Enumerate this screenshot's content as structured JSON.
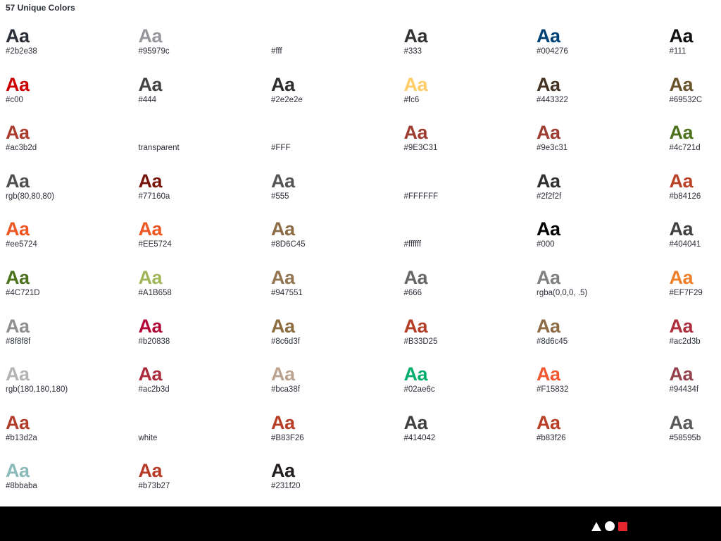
{
  "heading": "57 Unique Colors",
  "sample_text": "Aa",
  "colors": [
    {
      "label": "#2b2e38",
      "color": "#2b2e38"
    },
    {
      "label": "#95979c",
      "color": "#95979c"
    },
    {
      "label": "#fff",
      "color": "#ffffff"
    },
    {
      "label": "#333",
      "color": "#333333"
    },
    {
      "label": "#004276",
      "color": "#004276"
    },
    {
      "label": "#111",
      "color": "#111111"
    },
    {
      "label": "#c00",
      "color": "#cc0000"
    },
    {
      "label": "#444",
      "color": "#444444"
    },
    {
      "label": "#2e2e2e",
      "color": "#2e2e2e"
    },
    {
      "label": "#fc6",
      "color": "#ffcc66"
    },
    {
      "label": "#443322",
      "color": "#443322"
    },
    {
      "label": "#69532C",
      "color": "#69532c"
    },
    {
      "label": "#ac3b2d",
      "color": "#ac3b2d"
    },
    {
      "label": "transparent",
      "color": "transparent"
    },
    {
      "label": "#FFF",
      "color": "#ffffff"
    },
    {
      "label": "#9E3C31",
      "color": "#9e3c31"
    },
    {
      "label": "#9e3c31",
      "color": "#9e3c31"
    },
    {
      "label": "#4c721d",
      "color": "#4c721d"
    },
    {
      "label": "rgb(80,80,80)",
      "color": "#505050"
    },
    {
      "label": "#77160a",
      "color": "#77160a"
    },
    {
      "label": "#555",
      "color": "#555555"
    },
    {
      "label": "#FFFFFF",
      "color": "#ffffff"
    },
    {
      "label": "#2f2f2f",
      "color": "#2f2f2f"
    },
    {
      "label": "#b84126",
      "color": "#b84126"
    },
    {
      "label": "#ee5724",
      "color": "#ee5724"
    },
    {
      "label": "#EE5724",
      "color": "#ee5724"
    },
    {
      "label": "#8D6C45",
      "color": "#8d6c45"
    },
    {
      "label": "#ffffff",
      "color": "#ffffff"
    },
    {
      "label": "#000",
      "color": "#000000"
    },
    {
      "label": "#404041",
      "color": "#404041"
    },
    {
      "label": "#4C721D",
      "color": "#4c721d"
    },
    {
      "label": "#A1B658",
      "color": "#a1b658"
    },
    {
      "label": "#947551",
      "color": "#947551"
    },
    {
      "label": "#666",
      "color": "#666666"
    },
    {
      "label": "rgba(0,0,0, .5)",
      "color": "#808080"
    },
    {
      "label": "#EF7F29",
      "color": "#ef7f29"
    },
    {
      "label": "#8f8f8f",
      "color": "#8f8f8f"
    },
    {
      "label": "#b20838",
      "color": "#b20838"
    },
    {
      "label": "#8c6d3f",
      "color": "#8c6d3f"
    },
    {
      "label": "#B33D25",
      "color": "#b33d25"
    },
    {
      "label": "#8d6c45",
      "color": "#8d6c45"
    },
    {
      "label": "#ac2d3b",
      "color": "#ac2d3b"
    },
    {
      "label": "rgb(180,180,180)",
      "color": "#b4b4b4"
    },
    {
      "label": "#ac2b3d",
      "color": "#ac2b3d"
    },
    {
      "label": "#bca38f",
      "color": "#bca38f"
    },
    {
      "label": "#02ae6c",
      "color": "#02ae6c"
    },
    {
      "label": "#F15832",
      "color": "#f15832"
    },
    {
      "label": "#94434f",
      "color": "#94434f"
    },
    {
      "label": "#b13d2a",
      "color": "#b13d2a"
    },
    {
      "label": "white",
      "color": "#ffffff"
    },
    {
      "label": "#B83F26",
      "color": "#b83f26"
    },
    {
      "label": "#414042",
      "color": "#414042"
    },
    {
      "label": "#b83f26",
      "color": "#b83f26"
    },
    {
      "label": "#58595b",
      "color": "#58595b"
    },
    {
      "label": "#8bbaba",
      "color": "#8bbaba"
    },
    {
      "label": "#b73b27",
      "color": "#b73b27"
    },
    {
      "label": "#231f20",
      "color": "#231f20"
    }
  ],
  "footer": {
    "background": "#000000",
    "icons": [
      "triangle-icon",
      "circle-icon",
      "square-icon"
    ],
    "accent": "#e3262e"
  }
}
